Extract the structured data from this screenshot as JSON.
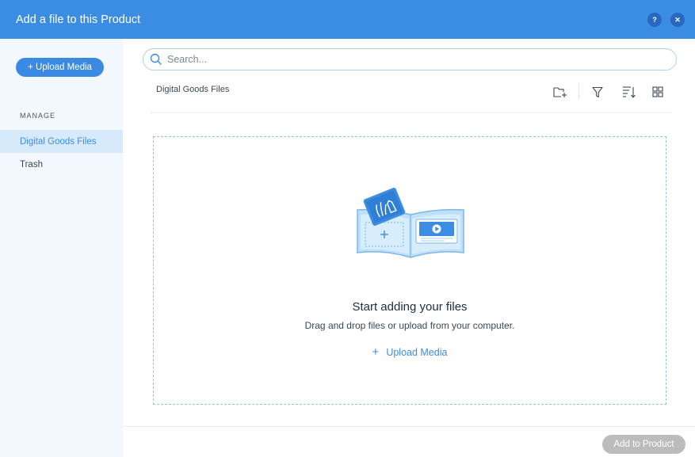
{
  "header": {
    "title": "Add a file to this Product",
    "help_label": "?",
    "close_label": "✕"
  },
  "sidebar": {
    "upload_button": "+ Upload Media",
    "section_label": "MANAGE",
    "items": [
      {
        "label": "Digital Goods Files",
        "active": true
      },
      {
        "label": "Trash",
        "active": false
      }
    ]
  },
  "search": {
    "placeholder": "Search...",
    "value": ""
  },
  "main": {
    "breadcrumb": "Digital Goods Files",
    "toolbar": {
      "icons": [
        "new-folder-icon",
        "filter-icon",
        "sort-icon",
        "grid-view-icon"
      ]
    },
    "empty_state": {
      "title": "Start adding your files",
      "description": "Drag and drop files or upload from your computer.",
      "upload_link": "Upload Media",
      "plus_glyph": "+"
    }
  },
  "footer": {
    "add_button": "Add to Product"
  },
  "colors": {
    "accent": "#3b8de4",
    "header_bg": "#3b8de4",
    "sidebar_bg": "#f2f8fd",
    "active_item_bg": "#d6eafb",
    "disabled_button": "#bcbcbc"
  }
}
